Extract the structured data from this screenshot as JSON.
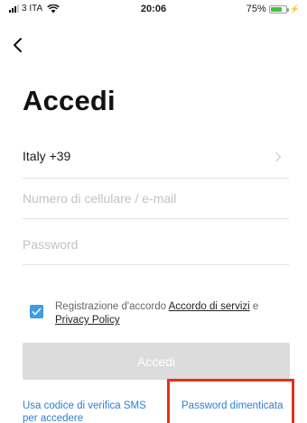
{
  "status_bar": {
    "carrier": "3 ITA",
    "time": "20:06",
    "battery_percent": "75%",
    "battery_level": 0.75,
    "battery_color": "#3bc63b"
  },
  "nav": {
    "back_icon": "chevron-left-icon"
  },
  "title": "Accedi",
  "form": {
    "country_value": "Italy +39",
    "phone_placeholder": "Numero di cellulare / e-mail",
    "password_placeholder": "Password"
  },
  "agreement": {
    "checked": true,
    "checkbox_color": "#3d9be9",
    "text_before": "Registrazione d'accordo ",
    "terms_link": "Accordo di servizi",
    "conjunction": " e",
    "privacy_link": "Privacy Policy"
  },
  "login_button_label": "Accedi",
  "links": {
    "sms_login": "Usa codice di verifica SMS per accedere",
    "forgot_password": "Password dimenticata"
  },
  "colors": {
    "link": "#2e7fd0",
    "button_disabled": "#dcdcdc",
    "highlight": "#e8301c"
  }
}
